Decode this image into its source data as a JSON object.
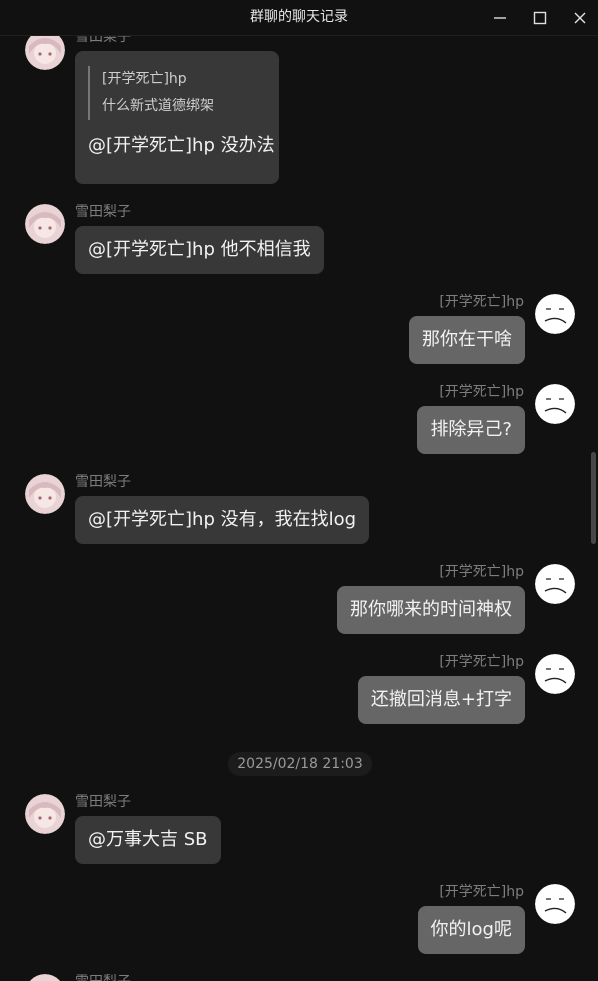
{
  "window": {
    "title": "群聊的聊天记录",
    "minimize_icon": "minimize-icon",
    "maximize_icon": "maximize-icon",
    "close_icon": "close-icon"
  },
  "contacts": {
    "left": "雪田梨子",
    "right": "[开学死亡]hp"
  },
  "messages": [
    {
      "sender": "雪田梨子",
      "quote_name": "[开学死亡]hp",
      "quote_text": "什么新式道德绑架",
      "text": "@[开学死亡]hp 没办法"
    },
    {
      "sender": "雪田梨子",
      "text": "@[开学死亡]hp 他不相信我"
    },
    {
      "sender": "[开学死亡]hp",
      "text": "那你在干啥"
    },
    {
      "sender": "[开学死亡]hp",
      "text": "排除异己?"
    },
    {
      "sender": "雪田梨子",
      "text": "@[开学死亡]hp 没有，我在找log"
    },
    {
      "sender": "[开学死亡]hp",
      "text": "那你哪来的时间神权"
    },
    {
      "sender": "[开学死亡]hp",
      "text": "还撤回消息+打字"
    },
    {
      "sender": "雪田梨子",
      "text": "@万事大吉 SB"
    },
    {
      "sender": "[开学死亡]hp",
      "text": "你的log呢"
    },
    {
      "sender": "雪田梨子",
      "text": ""
    }
  ],
  "timestamp": "2025/02/18 21:03",
  "colors": {
    "background": "#111111",
    "bubble_left": "#383838",
    "bubble_right": "#666666",
    "name_text": "#7d7d7d"
  }
}
